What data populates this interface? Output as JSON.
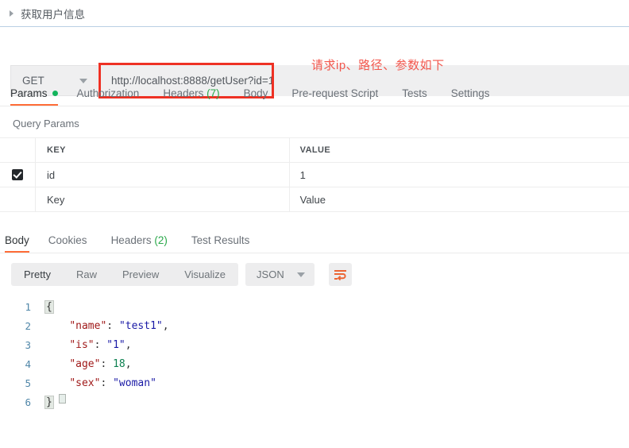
{
  "breadcrumb": {
    "label": "获取用户信息",
    "caret_icon": "triangle-right-icon"
  },
  "request": {
    "method": "GET",
    "method_caret_icon": "chevron-down-icon",
    "url": "http://localhost:8888/getUser?id=1",
    "annotation": "请求ip、路径、参数如下",
    "annotation_color": "#f2574d",
    "highlight_color": "#ee3124"
  },
  "request_tabs": [
    {
      "label": "Params",
      "badge": "",
      "dot": true,
      "active": true
    },
    {
      "label": "Authorization",
      "badge": "",
      "dot": false,
      "active": false
    },
    {
      "label": "Headers",
      "badge": "(7)",
      "dot": false,
      "active": false
    },
    {
      "label": "Body",
      "badge": "",
      "dot": false,
      "active": false
    },
    {
      "label": "Pre-request Script",
      "badge": "",
      "dot": false,
      "active": false
    },
    {
      "label": "Tests",
      "badge": "",
      "dot": false,
      "active": false
    },
    {
      "label": "Settings",
      "badge": "",
      "dot": false,
      "active": false
    }
  ],
  "query_params": {
    "title": "Query Params",
    "columns": {
      "key": "KEY",
      "value": "VALUE"
    },
    "rows": [
      {
        "checked": true,
        "key": "id",
        "value": "1",
        "placeholder": false
      },
      {
        "checked": false,
        "key": "Key",
        "value": "Value",
        "placeholder": true
      }
    ]
  },
  "response_tabs": [
    {
      "label": "Body",
      "badge": "",
      "active": true
    },
    {
      "label": "Cookies",
      "badge": "",
      "active": false
    },
    {
      "label": "Headers",
      "badge": "(2)",
      "active": false
    },
    {
      "label": "Test Results",
      "badge": "",
      "active": false
    }
  ],
  "body_toolbar": {
    "views": [
      {
        "label": "Pretty",
        "active": true
      },
      {
        "label": "Raw",
        "active": false
      },
      {
        "label": "Preview",
        "active": false
      },
      {
        "label": "Visualize",
        "active": false
      }
    ],
    "format": "JSON",
    "format_caret_icon": "chevron-down-icon",
    "wrap_icon": "word-wrap-icon",
    "wrap_icon_color": "#ec6534"
  },
  "response_body": {
    "line_numbers": [
      "1",
      "2",
      "3",
      "4",
      "5",
      "6"
    ],
    "lines": [
      {
        "n": "1",
        "type": "open",
        "text": "{"
      },
      {
        "n": "2",
        "type": "pair",
        "key": "\"name\"",
        "sep": ": ",
        "val": "\"test1\"",
        "val_type": "string",
        "tail": ","
      },
      {
        "n": "3",
        "type": "pair",
        "key": "\"is\"",
        "sep": ": ",
        "val": "\"1\"",
        "val_type": "string",
        "tail": ","
      },
      {
        "n": "4",
        "type": "pair",
        "key": "\"age\"",
        "sep": ": ",
        "val": "18",
        "val_type": "number",
        "tail": ","
      },
      {
        "n": "5",
        "type": "pair",
        "key": "\"sex\"",
        "sep": ": ",
        "val": "\"woman\"",
        "val_type": "string",
        "tail": ""
      },
      {
        "n": "6",
        "type": "close",
        "text": "}"
      }
    ],
    "colors": {
      "key": "#a01a1a",
      "string": "#1a1aa6",
      "number": "#0d8050"
    }
  }
}
